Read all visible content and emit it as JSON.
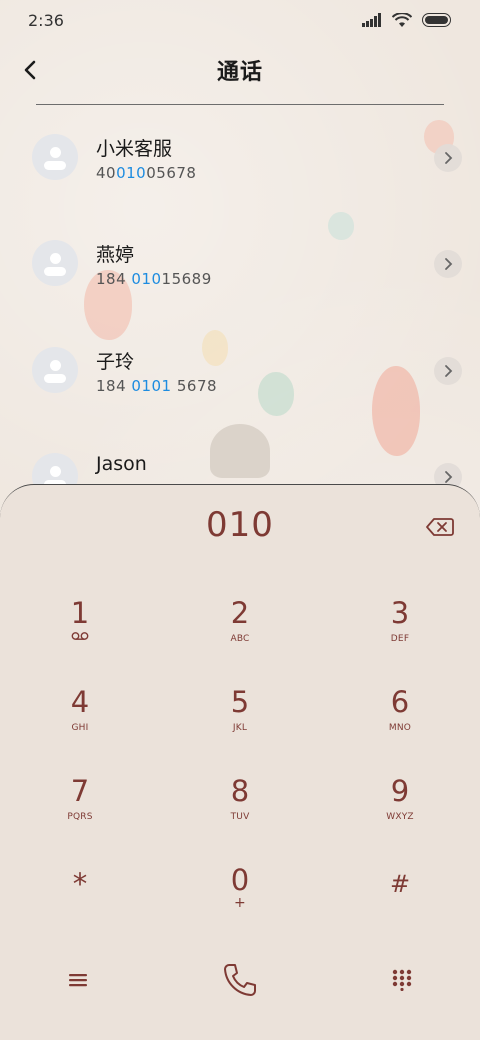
{
  "status_bar": {
    "time": "2:36"
  },
  "header": {
    "title": "通话"
  },
  "contacts": [
    {
      "name": "小米客服",
      "number_pre": "40",
      "number_hl": "010",
      "number_post": "05678"
    },
    {
      "name": "燕婷",
      "number_pre": "184 ",
      "number_hl": "010",
      "number_post": "15689"
    },
    {
      "name": "子玲",
      "number_pre": "184 ",
      "number_hl": "0101",
      "number_post": " 5678"
    },
    {
      "name": "Jason",
      "number_pre": "",
      "number_hl": "",
      "number_post": ""
    }
  ],
  "dialpad": {
    "display": "010",
    "keys": [
      {
        "digit": "1",
        "sub": ""
      },
      {
        "digit": "2",
        "sub": "ABC"
      },
      {
        "digit": "3",
        "sub": "DEF"
      },
      {
        "digit": "4",
        "sub": "GHI"
      },
      {
        "digit": "5",
        "sub": "JKL"
      },
      {
        "digit": "6",
        "sub": "MNO"
      },
      {
        "digit": "7",
        "sub": "PQRS"
      },
      {
        "digit": "8",
        "sub": "TUV"
      },
      {
        "digit": "9",
        "sub": "WXYZ"
      },
      {
        "digit": "*",
        "sub": ""
      },
      {
        "digit": "0",
        "sub": "+"
      },
      {
        "digit": "#",
        "sub": ""
      }
    ]
  },
  "colors": {
    "accent": "#7e3a34",
    "highlight": "#1d8ce0",
    "background": "#efe7df"
  }
}
